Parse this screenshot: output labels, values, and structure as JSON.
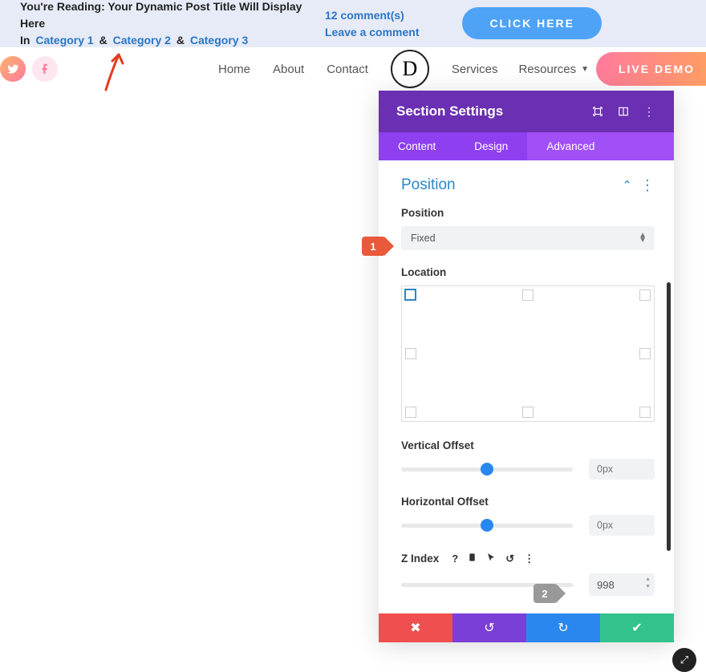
{
  "topbar": {
    "reading_prefix": "You're Reading: ",
    "post_title": "Your Dynamic Post Title Will Display Here",
    "in_label": "In",
    "categories": [
      "Category 1",
      "Category 2",
      "Category 3"
    ],
    "amp": "&",
    "comments_count": "12 comment(s)",
    "leave_comment": "Leave a comment",
    "cta": "CLICK HERE"
  },
  "nav": {
    "links_left": [
      "Home",
      "About",
      "Contact"
    ],
    "logo_letter": "D",
    "links_right": [
      "Services",
      "Resources"
    ],
    "live_demo": "LIVE DEMO"
  },
  "panel": {
    "title": "Section Settings",
    "tabs": {
      "content": "Content",
      "design": "Design",
      "advanced": "Advanced"
    },
    "group_title": "Position",
    "position_label": "Position",
    "position_value": "Fixed",
    "location_label": "Location",
    "vertical_offset_label": "Vertical Offset",
    "vertical_offset_value": "0px",
    "horizontal_offset_label": "Horizontal Offset",
    "horizontal_offset_value": "0px",
    "zindex_label": "Z Index",
    "zindex_value": "998"
  },
  "markers": {
    "m1": "1",
    "m2": "2"
  }
}
